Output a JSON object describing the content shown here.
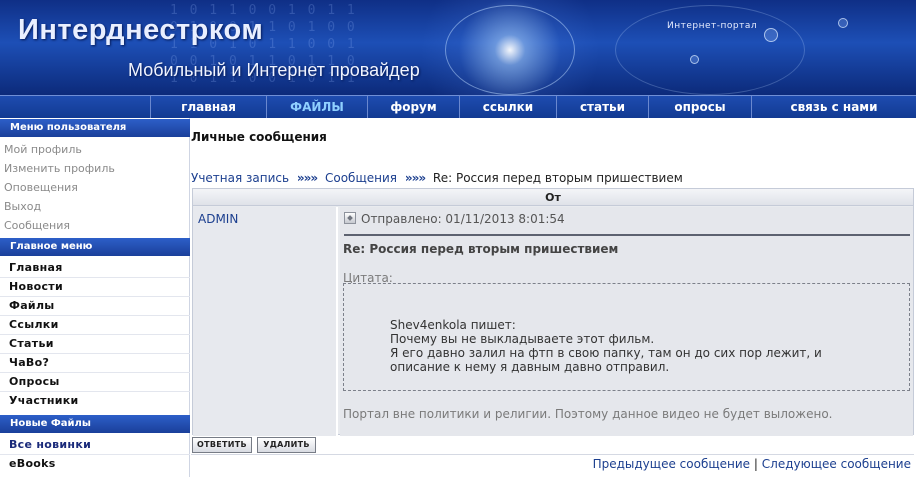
{
  "header": {
    "site_title": "Интерднестрком",
    "site_subtitle": "Мобильный и Интернет провайдер",
    "portal_label": "Интернет-портал"
  },
  "topnav": {
    "items": [
      {
        "label": "главная"
      },
      {
        "label": "ФАЙЛЫ"
      },
      {
        "label": "форум"
      },
      {
        "label": "ссылки"
      },
      {
        "label": "статьи"
      },
      {
        "label": "опросы"
      },
      {
        "label": "связь с нами"
      }
    ],
    "active_index": 1
  },
  "sidebar": {
    "user_menu": {
      "title": "Меню пользователя",
      "items": [
        "Мой профиль",
        "Изменить профиль",
        "Оповещения",
        "Выход",
        "Сообщения"
      ]
    },
    "main_menu": {
      "title": "Главное меню",
      "items": [
        "Главная",
        "Новости",
        "Файлы",
        "Ссылки",
        "Статьи",
        "ЧаВо?",
        "Опросы",
        "Участники"
      ]
    },
    "new_files": {
      "title": "Новые Файлы",
      "items": [
        "Все новинки",
        "eBooks"
      ]
    }
  },
  "main": {
    "page_title": "Личные сообщения",
    "breadcrumb": {
      "account": "Учетная запись",
      "messages": "Сообщения",
      "separator": "»»»",
      "current": "Re: Россия перед вторым пришествием"
    },
    "table_header": "От",
    "message": {
      "author": "ADMIN",
      "sent": "Отправлено: 01/11/2013 8:01:54",
      "subject": "Re: Россия перед вторым пришествием",
      "quote_label": "Цитата:",
      "quote_lines": [
        "Shev4enkola пишет:",
        "Почему вы не выкладываете этот фильм.",
        "Я его давно залил на фтп в свою папку, там он до сих пор лежит, и",
        "описание к нему я давным давно отправил."
      ],
      "reply_text": "Портал вне политики и религии. Поэтому данное видео не будет выложено."
    },
    "buttons": {
      "reply": "ОТВЕТИТЬ",
      "delete": "УДАЛИТЬ"
    },
    "pager": {
      "previous": "Предыдущее сообщение",
      "divider": "|",
      "next": "Следующее сообщение"
    }
  }
}
